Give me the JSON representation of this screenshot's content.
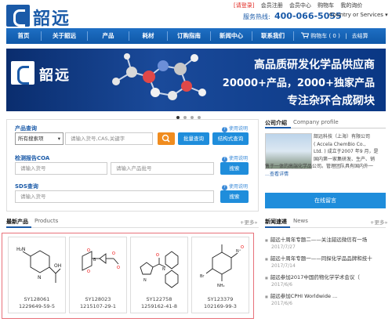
{
  "header": {
    "logo_text": "韶远",
    "top_links": [
      {
        "label": "[请登录]",
        "red": true
      },
      {
        "label": "会员注册"
      },
      {
        "label": "会员中心"
      },
      {
        "label": "购物车"
      },
      {
        "label": "我的询价"
      }
    ],
    "hotline_label": "服务热线:",
    "hotline_number": "400-066-5055",
    "country_label": "Country or Services",
    "country_arrow": "▾"
  },
  "nav": {
    "items": [
      "首页",
      "关于韶远",
      "产品",
      "耗材",
      "订购指南",
      "新闻中心",
      "联系我们"
    ],
    "cart_label": "购物车 ( 0 )",
    "checkout_label": "去结算"
  },
  "banner": {
    "logo_text": "韶远",
    "line1": "高品质研发化学品供应商",
    "line2": "20000+产品，2000+独家产品",
    "line3": "专注杂环合成砌块",
    "dots": 4,
    "active_dot": 0
  },
  "query": {
    "product": {
      "title": "产品查询",
      "usage": "使用说明",
      "select_value": "所有搜索项",
      "input_placeholder": "请输入货号,CAS,关键字",
      "batch_btn": "批量查询",
      "structure_btn": "结构式查询"
    },
    "coa": {
      "title": "检测报告COA",
      "usage": "使用说明",
      "code_placeholder": "请输入货号",
      "batch_placeholder": "请输入产品批号",
      "search_btn": "搜索"
    },
    "sds": {
      "title": "SDS查询",
      "usage": "使用说明",
      "code_placeholder": "请输入货号",
      "search_btn": "搜索"
    }
  },
  "company": {
    "title": "公司介绍",
    "title_en": "Company profile",
    "text_lines": [
      "韶远科技（上海）有限公司",
      "( Accela ChemBio Co.,",
      "Ltd. ) 成立于2007 年9 月，是",
      "国内第一家集研发、生产、销",
      "售于一体的高端化学品公司。管理团队具有国内外一"
    ],
    "more": "…查看详情",
    "online_btn": "在线留言"
  },
  "products": {
    "title": "最新产品",
    "title_en": "Products",
    "more": "+更多»",
    "items": [
      {
        "code": "SY128061",
        "cas": "1229649-59-5"
      },
      {
        "code": "SY128023",
        "cas": "1215107-29-1"
      },
      {
        "code": "SY122758",
        "cas": "1259162-41-8"
      },
      {
        "code": "SY123379",
        "cas": "102169-99-3"
      }
    ]
  },
  "news": {
    "title": "新闻速递",
    "title_en": "News",
    "more": "+更多»",
    "items": [
      {
        "text": "韶远十周年专题二——关注韶远微信有一场",
        "date": "2017/7/27"
      },
      {
        "text": "韶远十周年专题一——同探化学品品牌和技十",
        "date": "2017/7/14"
      },
      {
        "text": "韶远参加2017中国药物化学学术会议（",
        "date": "2017/6/6"
      },
      {
        "text": "韶远参加CPHI Worldwide ...",
        "date": "2017/6/6"
      }
    ]
  },
  "colors": {
    "brand_blue": "#1a5aa8",
    "button_blue": "#1f8ddb",
    "orange": "#f08c1f",
    "highlight_red": "#e8717a"
  }
}
